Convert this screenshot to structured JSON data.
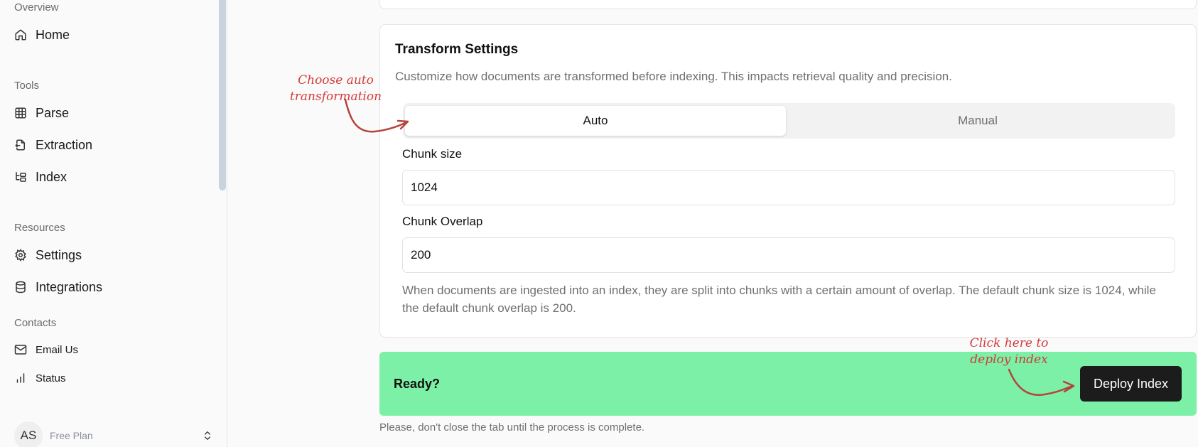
{
  "sidebar": {
    "overview_label": "Overview",
    "home": "Home",
    "tools_label": "Tools",
    "parse": "Parse",
    "extraction": "Extraction",
    "index": "Index",
    "resources_label": "Resources",
    "settings": "Settings",
    "integrations": "Integrations",
    "contacts_label": "Contacts",
    "email_us": "Email Us",
    "status": "Status",
    "account": {
      "initials": "AS",
      "plan": "Free Plan"
    }
  },
  "transform": {
    "title": "Transform Settings",
    "description": "Customize how documents are transformed before indexing. This impacts retrieval quality and precision.",
    "mode_auto": "Auto",
    "mode_manual": "Manual",
    "selected_mode": "Auto",
    "chunk_size_label": "Chunk size",
    "chunk_size_value": "1024",
    "chunk_overlap_label": "Chunk Overlap",
    "chunk_overlap_value": "200",
    "help_text": "When documents are ingested into an index, they are split into chunks with a certain amount of overlap. The default chunk size is 1024, while the default chunk overlap is 200."
  },
  "deploy": {
    "ready_label": "Ready?",
    "button_label": "Deploy Index",
    "note": "Please, don't close the tab until the process is complete."
  },
  "annotations": {
    "auto_line1": "Choose auto",
    "auto_line2": "transformation",
    "deploy_line1": "Click here to",
    "deploy_line2": "deploy index"
  },
  "colors": {
    "ready_bg": "#7bf0a6",
    "deploy_btn": "#1c1c1c",
    "annotation": "#d33a3a",
    "arrow": "#b5443c"
  }
}
